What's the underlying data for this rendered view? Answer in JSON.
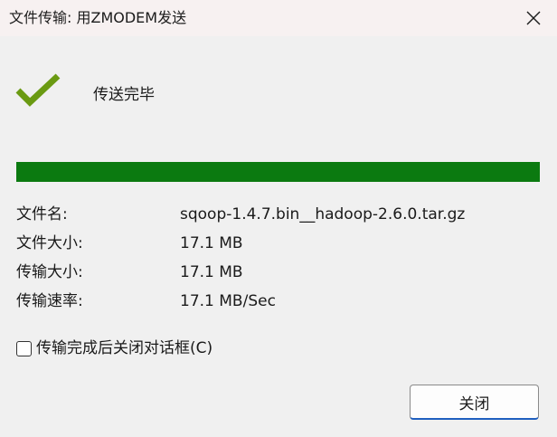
{
  "window": {
    "title": "文件传输: 用ZMODEM发送"
  },
  "status": {
    "icon": "checkmark-icon",
    "text": "传送完毕",
    "icon_color": "#6a9a12"
  },
  "progress": {
    "percent": 100,
    "color": "#0b7a10"
  },
  "info": [
    {
      "label": "文件名:",
      "value": "sqoop-1.4.7.bin__hadoop-2.6.0.tar.gz"
    },
    {
      "label": "文件大小:",
      "value": "17.1 MB"
    },
    {
      "label": "传输大小:",
      "value": "17.1 MB"
    },
    {
      "label": "传输速率:",
      "value": "17.1 MB/Sec"
    }
  ],
  "options": {
    "close_after_transfer": {
      "label": "传输完成后关闭对话框(C)",
      "checked": false
    }
  },
  "buttons": {
    "close_label": "关闭"
  }
}
